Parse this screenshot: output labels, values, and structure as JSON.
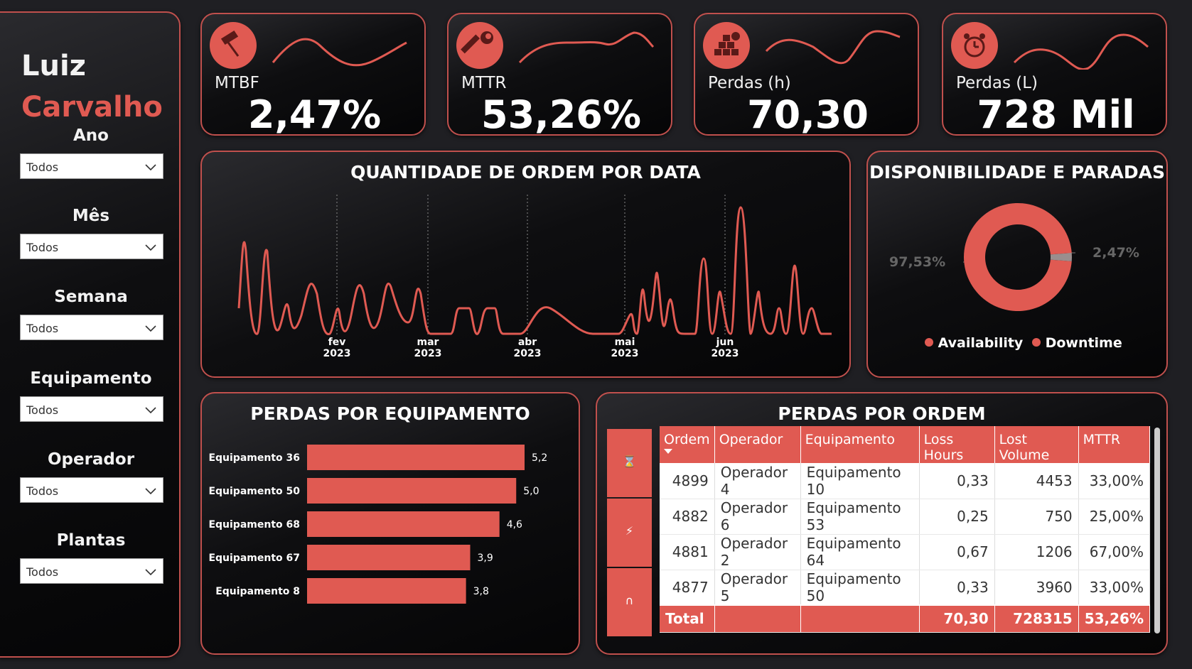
{
  "profile": {
    "first_name": "Luiz",
    "last_name": "Carvalho"
  },
  "filters": [
    {
      "label": "Ano",
      "value": "Todos"
    },
    {
      "label": "Mês",
      "value": "Todos"
    },
    {
      "label": "Semana",
      "value": "Todos"
    },
    {
      "label": "Equipamento",
      "value": "Todos"
    },
    {
      "label": "Operador",
      "value": "Todos"
    },
    {
      "label": "Plantas",
      "value": "Todos"
    }
  ],
  "kpis": [
    {
      "label": "MTBF",
      "value": "2,47%",
      "icon": "hammer-icon"
    },
    {
      "label": "MTTR",
      "value": "53,26%",
      "icon": "wrench-icon"
    },
    {
      "label": "Perdas (h)",
      "value": "70,30",
      "icon": "boxes-loss-icon"
    },
    {
      "label": "Perdas (L)",
      "value": "728 Mil",
      "icon": "alarm-clock-icon"
    }
  ],
  "colors": {
    "accent": "#e05a52",
    "border": "#c0504d",
    "background": "#1f1f23"
  },
  "line_chart": {
    "title": "QUANTIDADE DE ORDEM POR DATA",
    "x_labels": [
      "fev 2023",
      "mar 2023",
      "abr 2023",
      "mai 2023",
      "jun 2023"
    ]
  },
  "donut": {
    "title": "DISPONIBILIDADE E PARADAS",
    "availability_label": "97,53%",
    "downtime_label": "2,47%",
    "legend": [
      "Availability",
      "Downtime"
    ]
  },
  "bar_panel": {
    "title": "PERDAS POR EQUIPAMENTO"
  },
  "chart_data": [
    {
      "type": "bar",
      "title": "PERDAS POR EQUIPAMENTO",
      "categories": [
        "Equipamento 36",
        "Equipamento 50",
        "Equipamento 68",
        "Equipamento 67",
        "Equipamento 8"
      ],
      "values": [
        5.2,
        5.0,
        4.6,
        3.9,
        3.8
      ],
      "value_labels": [
        "5,2",
        "5,0",
        "4,6",
        "3,9",
        "3,8"
      ],
      "orientation": "horizontal"
    },
    {
      "type": "pie",
      "title": "DISPONIBILIDADE E PARADAS",
      "categories": [
        "Availability",
        "Downtime"
      ],
      "values": [
        97.53,
        2.47
      ]
    }
  ],
  "table": {
    "title": "PERDAS POR ORDEM",
    "columns": [
      "Ordem",
      "Operador",
      "Equipamento",
      "Loss Hours",
      "Lost Volume",
      "MTTR"
    ],
    "rows": [
      [
        "4899",
        "Operador 4",
        "Equipamento 10",
        "0,33",
        "4453",
        "33,00%"
      ],
      [
        "4882",
        "Operador 6",
        "Equipamento 53",
        "0,25",
        "750",
        "25,00%"
      ],
      [
        "4881",
        "Operador 2",
        "Equipamento 64",
        "0,67",
        "1206",
        "67,00%"
      ],
      [
        "4877",
        "Operador 5",
        "Equipamento 50",
        "0,33",
        "3960",
        "33,00%"
      ]
    ],
    "total": [
      "Total",
      "",
      "",
      "70,30",
      "728315",
      "53,26%"
    ],
    "side_buttons": [
      "hourglass-icon",
      "lightning-icon",
      "magnet-icon"
    ]
  }
}
